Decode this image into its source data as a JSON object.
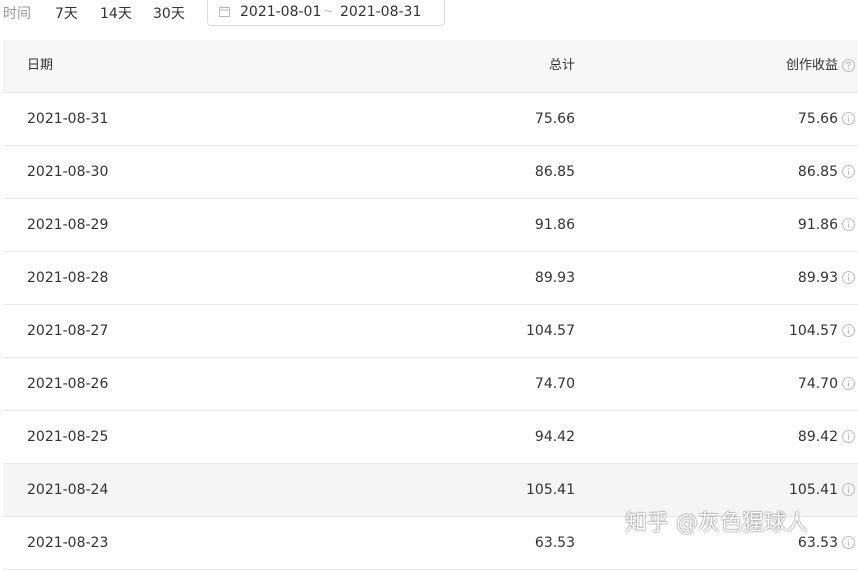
{
  "filter": {
    "label": "时间",
    "ranges": [
      "7天",
      "14天",
      "30天"
    ],
    "date_start": "2021-08-01",
    "date_separator": "~",
    "date_end": "2021-08-31"
  },
  "table": {
    "headers": {
      "date": "日期",
      "total": "总计",
      "earnings": "创作收益"
    },
    "rows": [
      {
        "date": "2021-08-31",
        "total": "75.66",
        "earnings": "75.66"
      },
      {
        "date": "2021-08-30",
        "total": "86.85",
        "earnings": "86.85"
      },
      {
        "date": "2021-08-29",
        "total": "91.86",
        "earnings": "91.86"
      },
      {
        "date": "2021-08-28",
        "total": "89.93",
        "earnings": "89.93"
      },
      {
        "date": "2021-08-27",
        "total": "104.57",
        "earnings": "104.57"
      },
      {
        "date": "2021-08-26",
        "total": "74.70",
        "earnings": "74.70"
      },
      {
        "date": "2021-08-25",
        "total": "94.42",
        "earnings": "89.42"
      },
      {
        "date": "2021-08-24",
        "total": "105.41",
        "earnings": "105.41"
      },
      {
        "date": "2021-08-23",
        "total": "63.53",
        "earnings": "63.53"
      }
    ],
    "highlighted_row": "2021-08-24"
  },
  "watermark": "知乎 @灰色猩球人",
  "icons": {
    "date_picker": "calendar-icon",
    "header_help": "question-circle-icon",
    "row_info": "info-circle-icon"
  },
  "colors": {
    "header_bg": "#f7f7f7",
    "row_border": "#e8e8e8",
    "highlight_row_bg": "#f5f5f5",
    "muted_text": "#999999"
  }
}
